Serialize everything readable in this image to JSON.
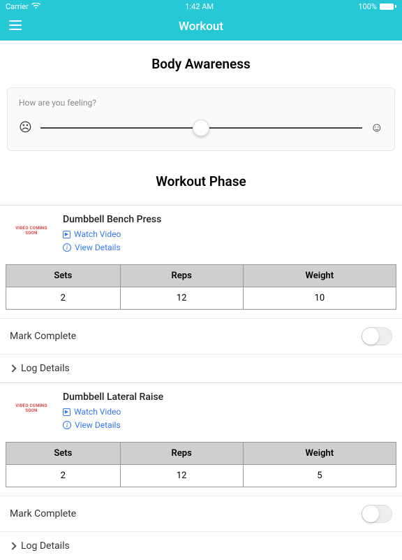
{
  "status": {
    "carrier": "Carrier",
    "time": "1:42 AM",
    "battery": "100%"
  },
  "nav": {
    "title": "Workout"
  },
  "section1": {
    "title": "Body Awareness"
  },
  "slider": {
    "label": "How are you feeling?",
    "faceSad": "☹",
    "faceHappy": "☺"
  },
  "section2": {
    "title": "Workout Phase"
  },
  "thumb": {
    "text": "VIDEO COMING SOON"
  },
  "links": {
    "watch": "Watch Video",
    "details": "View Details"
  },
  "tableHeaders": {
    "sets": "Sets",
    "reps": "Reps",
    "weight": "Weight"
  },
  "exercises": [
    {
      "name": "Dumbbell Bench Press",
      "sets": "2",
      "reps": "12",
      "weight": "10"
    },
    {
      "name": "Dumbbell Lateral Raise",
      "sets": "2",
      "reps": "12",
      "weight": "5"
    }
  ],
  "labels": {
    "markComplete": "Mark Complete",
    "logDetails": "Log Details"
  }
}
